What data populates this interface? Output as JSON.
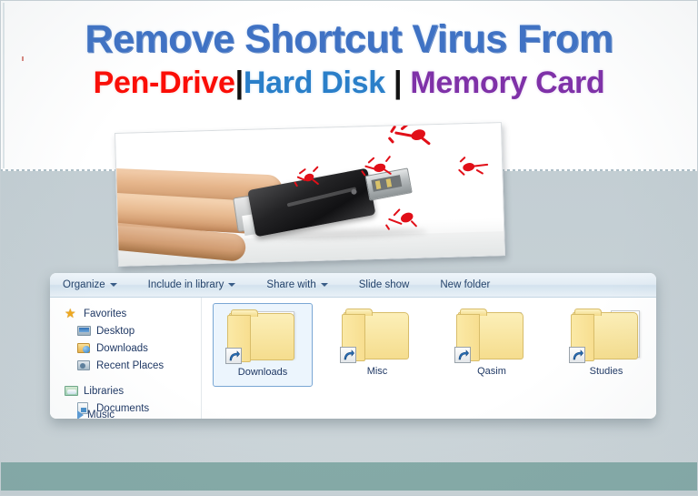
{
  "headline": {
    "line1": "Remove Shortcut Virus From",
    "line2_part1": "Pen-Drive",
    "line2_sep1": "|",
    "line2_part2": "Hard Disk",
    "line2_sep2": "|",
    "line2_part3": "Memory Card",
    "colors": {
      "line1": "#3f72c4",
      "pen_drive": "#fb0d06",
      "hard_disk": "#2a7fc9",
      "memory_card": "#7f31a8",
      "separator": "#111111"
    }
  },
  "photo": {
    "alt": "hand-holding-usb-flash-drive-with-red-virus-particles",
    "usb_icon": "usb-flash-drive-icon",
    "hand_icon": "hand-icon",
    "virus_icon": "virus-particle-icon",
    "virus_color": "#e10f18",
    "virus_count": 5
  },
  "explorer": {
    "toolbar": {
      "items": [
        {
          "label": "Organize",
          "caret": true,
          "name": "organize"
        },
        {
          "label": "Include in library",
          "caret": true,
          "name": "include-in-library"
        },
        {
          "label": "Share with",
          "caret": true,
          "name": "share-with"
        },
        {
          "label": "Slide show",
          "caret": false,
          "name": "slide-show"
        },
        {
          "label": "New folder",
          "caret": false,
          "name": "new-folder"
        }
      ]
    },
    "nav": {
      "groups": [
        {
          "label": "Favorites",
          "icon": "star-icon",
          "name": "favorites",
          "children": [
            {
              "label": "Desktop",
              "icon": "desktop-icon",
              "name": "desktop"
            },
            {
              "label": "Downloads",
              "icon": "downloads-folder-icon",
              "name": "downloads"
            },
            {
              "label": "Recent Places",
              "icon": "recent-places-icon",
              "name": "recent-places"
            }
          ]
        },
        {
          "label": "Libraries",
          "icon": "libraries-icon",
          "name": "libraries",
          "children": [
            {
              "label": "Documents",
              "icon": "documents-icon",
              "name": "documents"
            }
          ]
        }
      ],
      "truncated_row": "Music"
    },
    "tiles": [
      {
        "label": "Downloads",
        "selected": true,
        "icon": "folder-shortcut-icon",
        "name": "downloads"
      },
      {
        "label": "Misc",
        "selected": false,
        "icon": "folder-shortcut-icon",
        "name": "misc"
      },
      {
        "label": "Qasim",
        "selected": false,
        "icon": "folder-shortcut-icon",
        "name": "qasim"
      },
      {
        "label": "Studies",
        "selected": false,
        "icon": "folder-shortcut-icon",
        "name": "studies"
      }
    ],
    "shortcut_overlay_icon": "shortcut-arrow-icon"
  },
  "background": {
    "top_band": "#ffffff",
    "middle_band": "#c7d1d6",
    "bottom_band": "#84aaa7",
    "divider": "dashed-line"
  }
}
